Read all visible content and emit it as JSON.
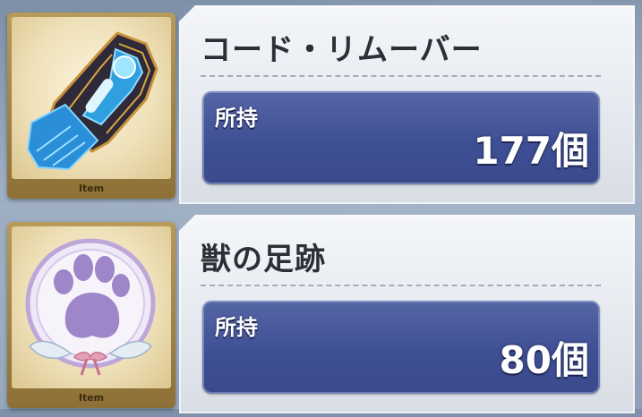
{
  "items": [
    {
      "name": "コード・リムーバー",
      "thumb_label": "Item",
      "icon": "code-remover-icon",
      "owned_label": "所持",
      "owned_value": "177個"
    },
    {
      "name": "獣の足跡",
      "thumb_label": "Item",
      "icon": "beast-footprint-icon",
      "owned_label": "所持",
      "owned_value": "80個"
    }
  ],
  "colors": {
    "thumb_frame": "#b89a5a",
    "count_box": "#3f4f94",
    "panel_bg": "#e4e8ee"
  }
}
